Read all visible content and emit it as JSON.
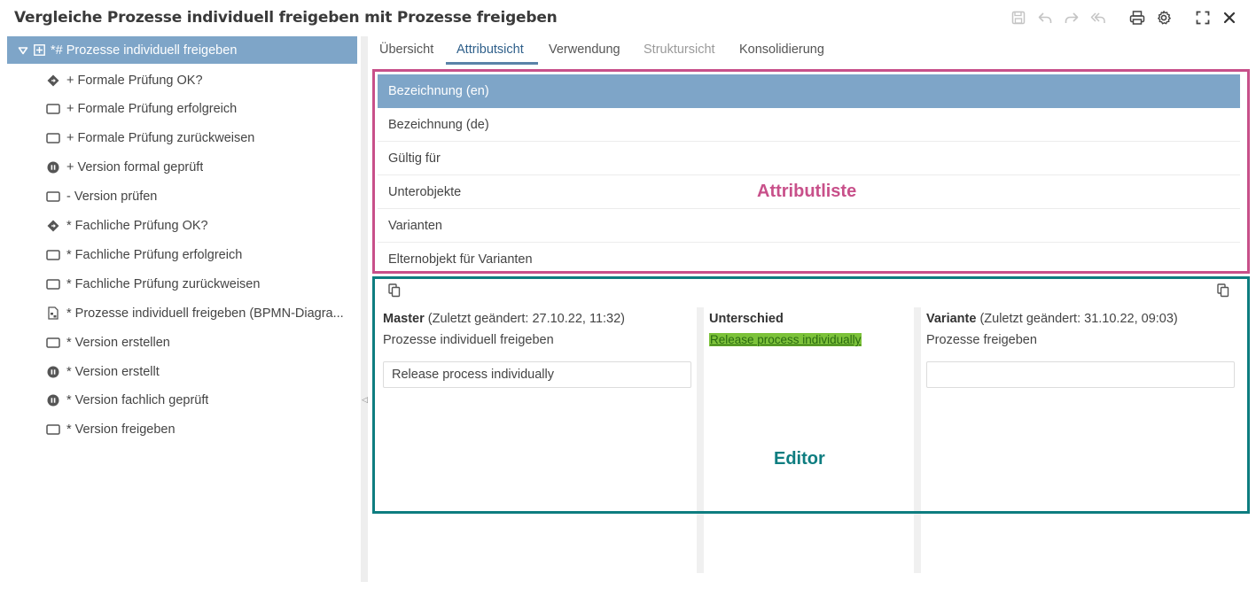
{
  "window": {
    "title": "Vergleiche Prozesse individuell freigeben mit Prozesse freigeben"
  },
  "toolbar": {
    "icons": [
      "save-icon",
      "undo-icon",
      "redo-icon",
      "reply-all-icon",
      "print-icon",
      "gear-icon",
      "fullscreen-icon",
      "close-icon"
    ]
  },
  "tree": {
    "root": {
      "label": "*# Prozesse individuell freigeben"
    },
    "items": [
      {
        "icon": "gateway-icon",
        "label": "+ Formale Prüfung OK?"
      },
      {
        "icon": "task-icon",
        "label": "+ Formale Prüfung erfolgreich"
      },
      {
        "icon": "task-icon",
        "label": "+ Formale Prüfung zurückweisen"
      },
      {
        "icon": "event-icon",
        "label": "+ Version formal geprüft"
      },
      {
        "icon": "task-icon",
        "label": "- Version prüfen"
      },
      {
        "icon": "gateway-icon",
        "label": "* Fachliche Prüfung OK?"
      },
      {
        "icon": "task-icon",
        "label": "* Fachliche Prüfung erfolgreich"
      },
      {
        "icon": "task-icon",
        "label": "* Fachliche Prüfung zurückweisen"
      },
      {
        "icon": "diagram-icon",
        "label": "* Prozesse individuell freigeben (BPMN-Diagra..."
      },
      {
        "icon": "task-icon",
        "label": "* Version erstellen"
      },
      {
        "icon": "event-icon",
        "label": "* Version erstellt"
      },
      {
        "icon": "event-icon",
        "label": "* Version fachlich geprüft"
      },
      {
        "icon": "task-icon",
        "label": "* Version freigeben"
      }
    ]
  },
  "tabs": [
    {
      "label": "Übersicht",
      "state": "normal"
    },
    {
      "label": "Attributsicht",
      "state": "active"
    },
    {
      "label": "Verwendung",
      "state": "normal"
    },
    {
      "label": "Struktursicht",
      "state": "disabled"
    },
    {
      "label": "Konsolidierung",
      "state": "normal"
    }
  ],
  "attributes": [
    {
      "label": "Bezeichnung (en)",
      "selected": true
    },
    {
      "label": "Bezeichnung (de)",
      "selected": false
    },
    {
      "label": "Gültig für",
      "selected": false
    },
    {
      "label": "Unterobjekte",
      "selected": false
    },
    {
      "label": "Varianten",
      "selected": false
    },
    {
      "label": "Elternobjekt für Varianten",
      "selected": false
    }
  ],
  "annotations": {
    "attribute_list": "Attributliste",
    "editor": "Editor"
  },
  "editor": {
    "master": {
      "title": "Master",
      "changed": "(Zuletzt geändert: 27.10.22, 11:32)",
      "name": "Prozesse individuell freigeben",
      "value": "Release process individually"
    },
    "difference": {
      "title": "Unterschied",
      "value": "Release process individually"
    },
    "variant": {
      "title": "Variante",
      "changed": "(Zuletzt geändert: 31.10.22, 09:03)",
      "name": "Prozesse freigeben",
      "value": ""
    }
  },
  "colors": {
    "selection": "#7ea5c8",
    "annotation_pink": "#c8508a",
    "annotation_teal": "#0e7d80",
    "diff_highlight": "#7cc23a"
  }
}
